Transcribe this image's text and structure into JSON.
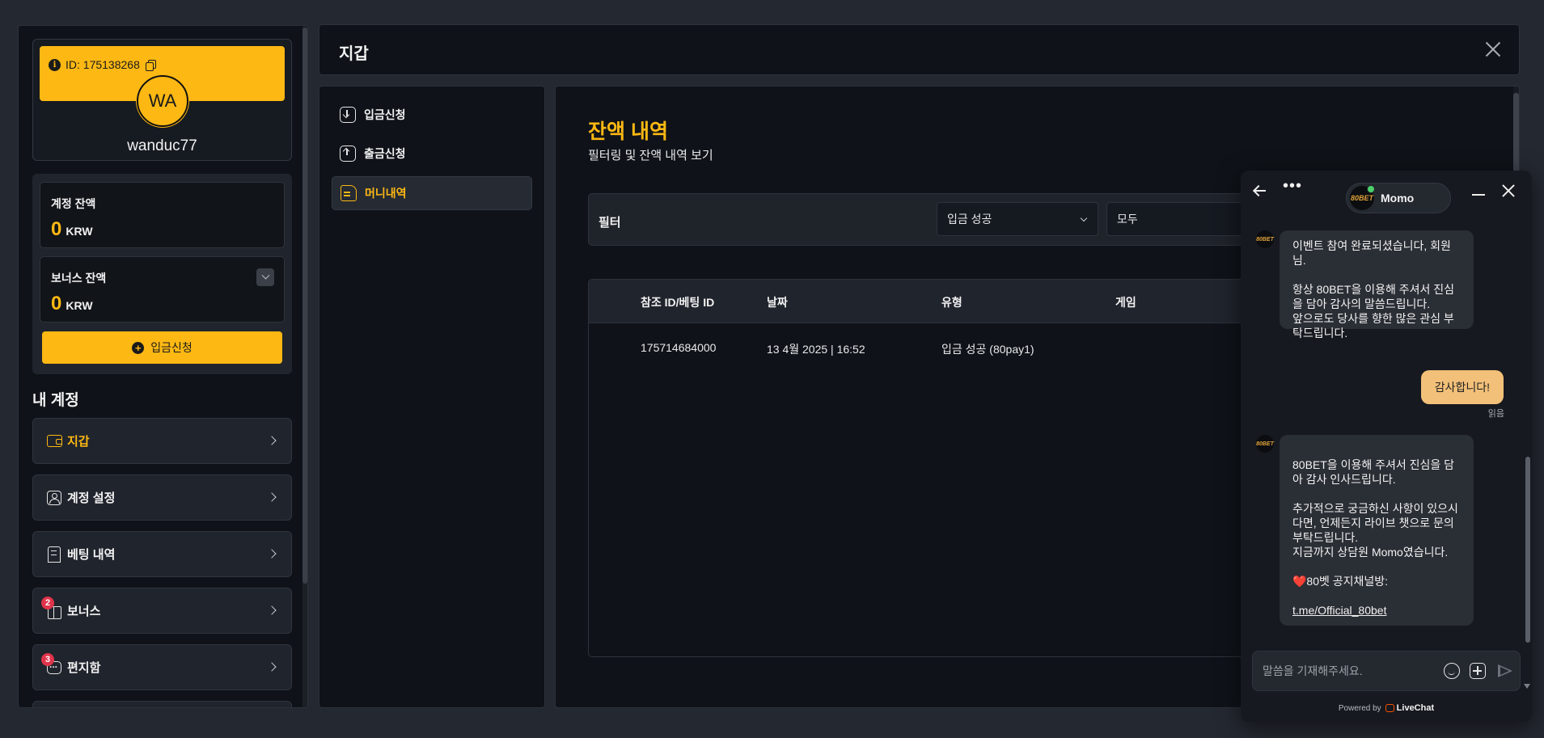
{
  "sidebar": {
    "profile": {
      "id_label": "ID: 175138268",
      "avatar_initials": "WA",
      "username": "wanduc77"
    },
    "account_balance": {
      "label": "계정 잔액",
      "value": "0",
      "currency": "KRW"
    },
    "bonus_balance": {
      "label": "보너스 잔액",
      "value": "0",
      "currency": "KRW"
    },
    "deposit_button": "입금신청",
    "section_title": "내 계정",
    "menu": [
      {
        "label": "지갑",
        "icon": "wallet-icon",
        "active": true
      },
      {
        "label": "계정 설정",
        "icon": "user-settings-icon"
      },
      {
        "label": "베팅 내역",
        "icon": "receipt-icon"
      },
      {
        "label": "보너스",
        "icon": "gift-icon",
        "badge": "2"
      },
      {
        "label": "편지함",
        "icon": "message-icon",
        "badge": "3"
      }
    ]
  },
  "header": {
    "title": "지갑"
  },
  "wallet_nav": [
    {
      "label": "입금신청",
      "icon": "deposit-icon"
    },
    {
      "label": "출금신청",
      "icon": "withdraw-icon"
    },
    {
      "label": "머니내역",
      "icon": "document-icon",
      "active": true
    }
  ],
  "history": {
    "title": "잔액 내역",
    "subtitle": "필터링 및 잔액 내역 보기",
    "filter_label": "필터",
    "filter_status": "입금 성공",
    "filter_game": "모두",
    "columns": [
      "참조 ID/베팅 ID",
      "날짜",
      "유형",
      "게임"
    ],
    "rows": [
      {
        "ref_id": "175714684000",
        "date": "13 4월 2025 | 16:52",
        "type": "입금 성공 (80pay1)",
        "game": ""
      }
    ]
  },
  "chat": {
    "agent_name": "Momo",
    "logo_text": "80BET",
    "messages": [
      {
        "from": "agent",
        "text": "이벤트 참여 완료되셨습니다, 회원님.\n\n항상 80BET을 이용해 주셔서 진심을 담아 감사의 말씀드립니다.\n앞으로도 당사를 향한 많은 관심 부탁드립니다."
      },
      {
        "from": "user",
        "text": "감사합니다!",
        "status": "읽음"
      },
      {
        "from": "agent",
        "text": "80BET을 이용해 주셔서 진심을 담아 감사 인사드립니다.\n\n추가적으로 궁금하신 사항이 있으시다면, 언제든지 라이브 챗으로 문의 부탁드립니다.\n지금까지 상담원 Momo였습니다.\n\n❤️80벳 공지채널방:",
        "link": "t.me/Official_80bet"
      }
    ],
    "input_placeholder": "말씀을 기재해주세요.",
    "powered_by": "Powered by",
    "brand": "LiveChat"
  }
}
